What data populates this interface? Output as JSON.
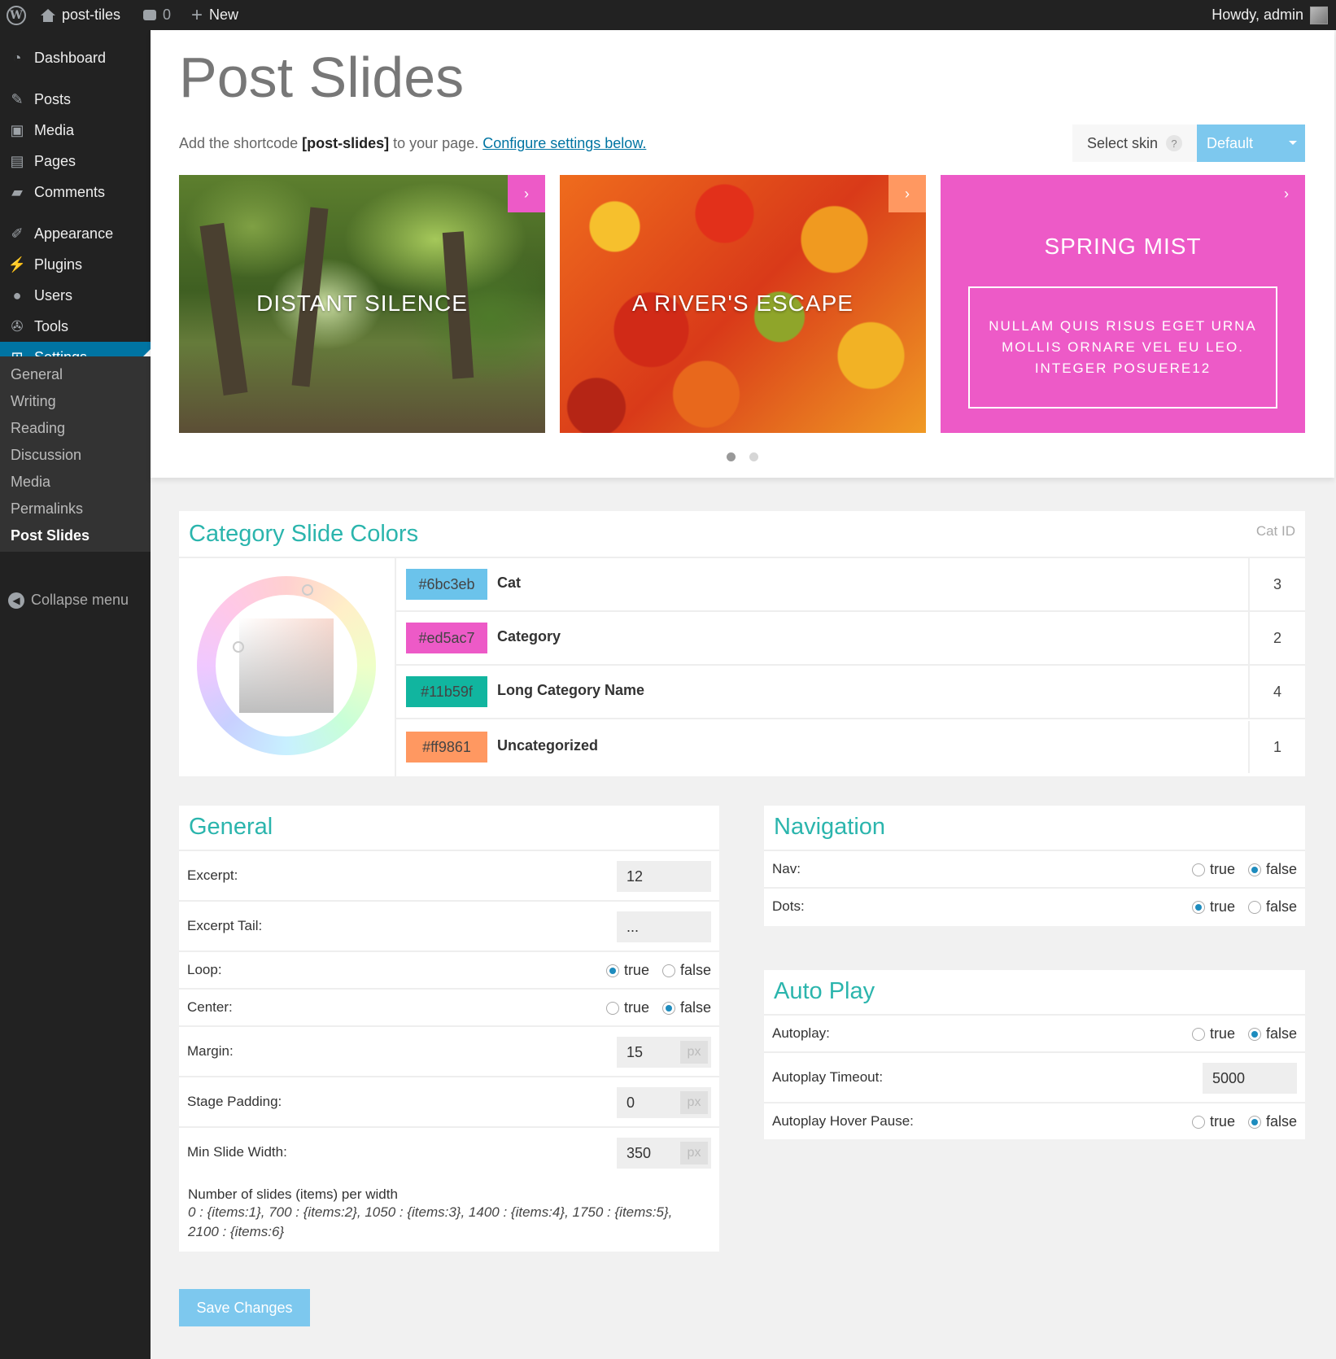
{
  "adminbar": {
    "site_name": "post-tiles",
    "comments_count": "0",
    "new_label": "New",
    "howdy": "Howdy, admin"
  },
  "sidebar": {
    "items": [
      {
        "label": "Dashboard",
        "icon": "dashboard-icon"
      },
      {
        "label": "Posts",
        "icon": "pin-icon"
      },
      {
        "label": "Media",
        "icon": "media-icon"
      },
      {
        "label": "Pages",
        "icon": "pages-icon"
      },
      {
        "label": "Comments",
        "icon": "comment-icon"
      },
      {
        "label": "Appearance",
        "icon": "brush-icon"
      },
      {
        "label": "Plugins",
        "icon": "plug-icon"
      },
      {
        "label": "Users",
        "icon": "user-icon"
      },
      {
        "label": "Tools",
        "icon": "wrench-icon"
      },
      {
        "label": "Settings",
        "icon": "settings-icon"
      }
    ],
    "submenu": [
      "General",
      "Writing",
      "Reading",
      "Discussion",
      "Media",
      "Permalinks",
      "Post Slides"
    ],
    "collapse_label": "Collapse menu"
  },
  "page": {
    "title": "Post Slides",
    "shortcode_prefix": "Add the shortcode ",
    "shortcode": "[post-slides]",
    "shortcode_mid": " to your page. ",
    "configure_link": "Configure settings below.",
    "select_skin_label": "Select skin",
    "skin_value": "Default"
  },
  "slides": [
    {
      "title": "DISTANT  SILENCE"
    },
    {
      "title": "A  RIVER'S  ESCAPE"
    },
    {
      "title": "SPRING  MIST",
      "excerpt": "NULLAM QUIS RISUS EGET URNA MOLLIS ORNARE VEL EU LEO. INTEGER POSUERE12"
    }
  ],
  "category_colors": {
    "title": "Category Slide Colors",
    "cat_id_label": "Cat ID",
    "rows": [
      {
        "color": "#6bc3eb",
        "name": "Cat",
        "id": "3"
      },
      {
        "color": "#ed5ac7",
        "name": "Category",
        "id": "2"
      },
      {
        "color": "#11b59f",
        "name": "Long Category Name",
        "id": "4"
      },
      {
        "color": "#ff9861",
        "name": "Uncategorized",
        "id": "1"
      }
    ]
  },
  "general": {
    "title": "General",
    "excerpt_label": "Excerpt:",
    "excerpt_value": "12",
    "excerpt_tail_label": "Excerpt Tail:",
    "excerpt_tail_value": "...",
    "loop_label": "Loop:",
    "center_label": "Center:",
    "margin_label": "Margin:",
    "margin_value": "15",
    "stage_padding_label": "Stage Padding:",
    "stage_padding_value": "0",
    "min_slide_width_label": "Min Slide Width:",
    "min_slide_width_value": "350",
    "px_unit": "px",
    "note_title": "Number of slides (items) per width",
    "note_line1": "0 : {items:1}, 700 : {items:2}, 1050 : {items:3}, 1400 : {items:4}, 1750 : {items:5},",
    "note_line2": "2100 : {items:6}"
  },
  "navigation": {
    "title": "Navigation",
    "nav_label": "Nav:",
    "dots_label": "Dots:"
  },
  "autoplay": {
    "title": "Auto Play",
    "autoplay_label": "Autoplay:",
    "timeout_label": "Autoplay Timeout:",
    "timeout_value": "5000",
    "hover_pause_label": "Autoplay Hover Pause:"
  },
  "radio_labels": {
    "true": "true",
    "false": "false"
  },
  "save_label": "Save Changes",
  "colors": {
    "accent": "#2bb5ad",
    "button": "#7dc8ee",
    "sidebar": "#222222",
    "active": "#0074a2"
  }
}
